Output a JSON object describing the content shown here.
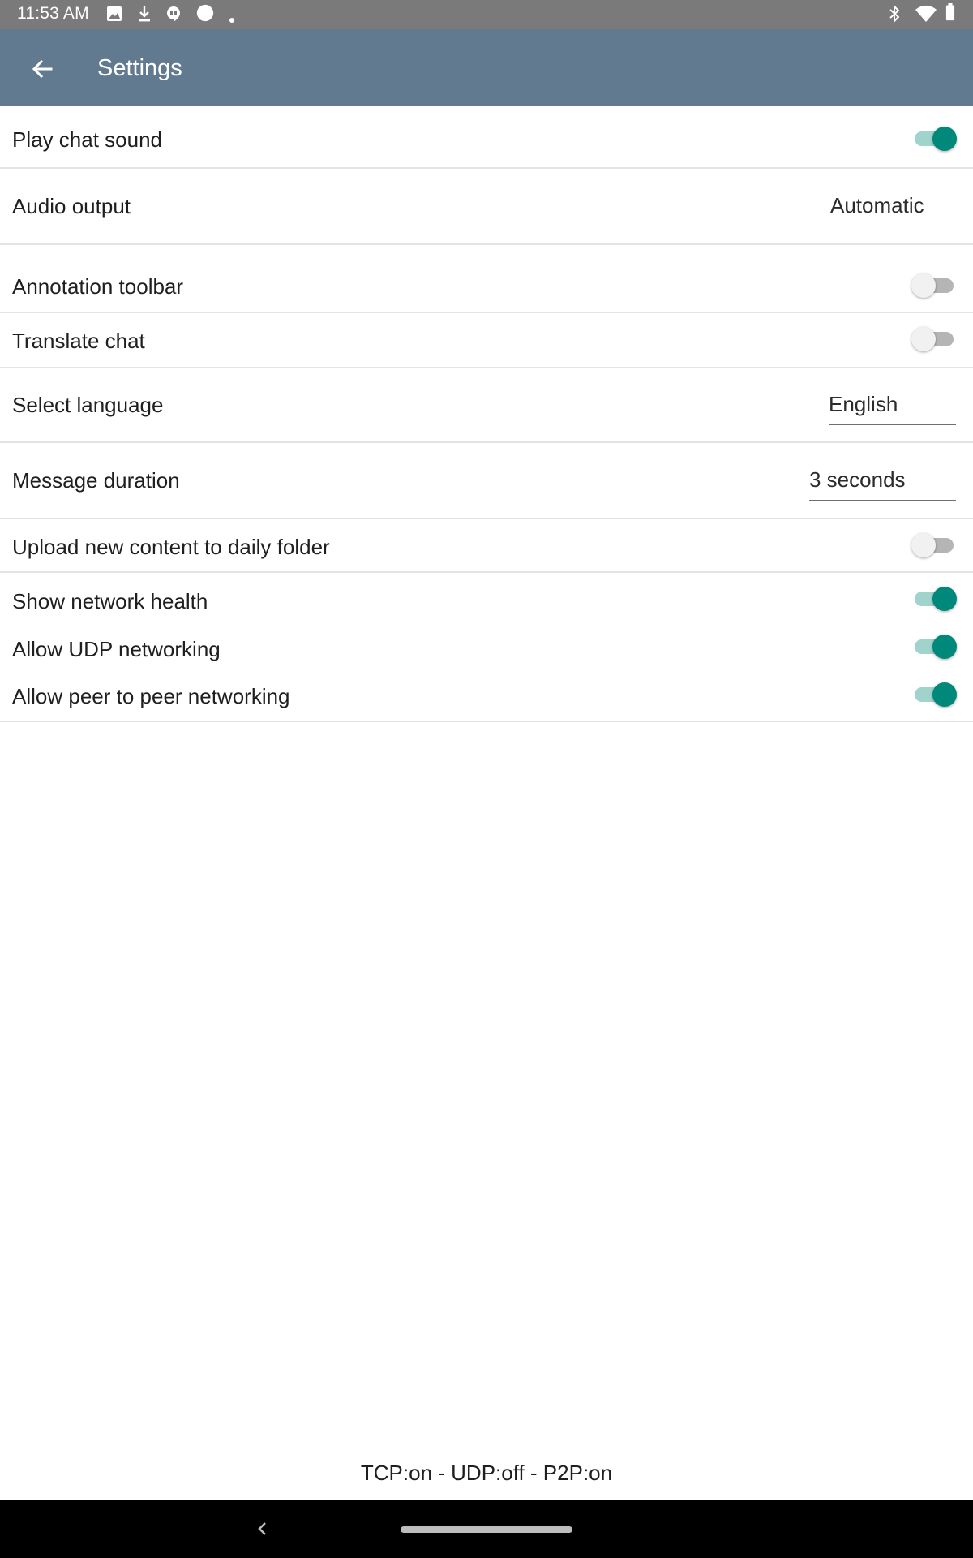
{
  "status_bar": {
    "time": "11:53 AM",
    "icons": [
      "image-icon",
      "download-icon",
      "hangouts-icon",
      "circle-icon",
      "dot-icon",
      "bluetooth-icon",
      "wifi-icon",
      "battery-icon"
    ]
  },
  "app_bar": {
    "back_icon": "arrow-left-icon",
    "title": "Settings",
    "color": "#617a8f"
  },
  "settings": {
    "play_chat_sound": {
      "label": "Play chat sound",
      "checked": true
    },
    "audio_output": {
      "label": "Audio output",
      "value": "Automatic"
    },
    "annotation_toolbar": {
      "label": "Annotation toolbar",
      "checked": false
    },
    "translate_chat": {
      "label": "Translate chat",
      "checked": false
    },
    "select_language": {
      "label": "Select language",
      "value": "English"
    },
    "message_duration": {
      "label": "Message duration",
      "value": "3 seconds"
    },
    "upload_daily_folder": {
      "label": "Upload new content to daily folder",
      "checked": false
    },
    "show_network_health": {
      "label": "Show network health",
      "checked": true
    },
    "allow_udp": {
      "label": "Allow UDP networking",
      "checked": true
    },
    "allow_p2p": {
      "label": "Allow peer to peer networking",
      "checked": true
    }
  },
  "footer": {
    "network_status": "TCP:on - UDP:off - P2P:on"
  },
  "colors": {
    "switch_on": "#00897b",
    "switch_track_on": "#9fd3cc",
    "switch_off": "#f1f1f1"
  }
}
